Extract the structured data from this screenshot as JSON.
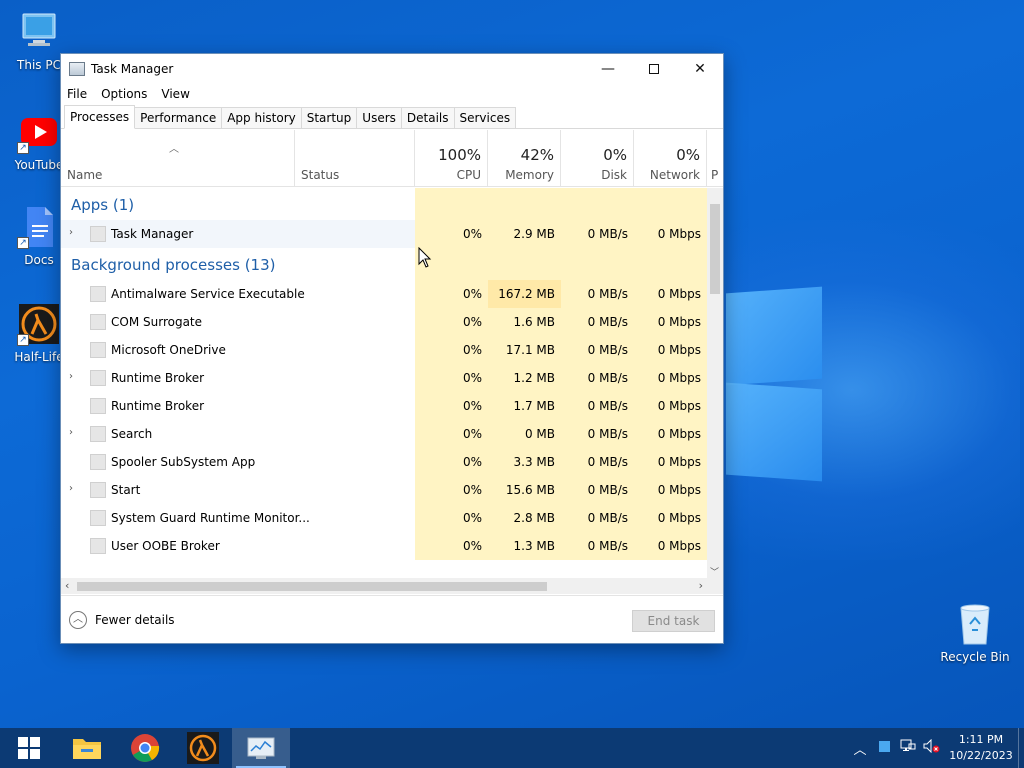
{
  "desktop": {
    "icons": [
      {
        "label": "This PC"
      },
      {
        "label": "YouTube"
      },
      {
        "label": "Docs"
      },
      {
        "label": "Half-Life"
      }
    ],
    "recycle_bin": "Recycle Bin"
  },
  "window": {
    "title": "Task Manager",
    "menu": [
      "File",
      "Options",
      "View"
    ],
    "tabs": [
      "Processes",
      "Performance",
      "App history",
      "Startup",
      "Users",
      "Details",
      "Services"
    ],
    "active_tab": "Processes",
    "columns": {
      "name": "Name",
      "status": "Status",
      "cpu": {
        "pct": "100%",
        "label": "CPU"
      },
      "memory": {
        "pct": "42%",
        "label": "Memory"
      },
      "disk": {
        "pct": "0%",
        "label": "Disk"
      },
      "network": {
        "pct": "0%",
        "label": "Network"
      },
      "power_partial": "P"
    },
    "groups": {
      "apps": "Apps (1)",
      "background": "Background processes (13)"
    },
    "apps": [
      {
        "name": "Task Manager",
        "cpu": "0%",
        "mem": "2.9 MB",
        "disk": "0 MB/s",
        "net": "0 Mbps",
        "expandable": true
      }
    ],
    "background": [
      {
        "name": "Antimalware Service Executable",
        "cpu": "0%",
        "mem": "167.2 MB",
        "disk": "0 MB/s",
        "net": "0 Mbps",
        "expandable": false
      },
      {
        "name": "COM Surrogate",
        "cpu": "0%",
        "mem": "1.6 MB",
        "disk": "0 MB/s",
        "net": "0 Mbps",
        "expandable": false
      },
      {
        "name": "Microsoft OneDrive",
        "cpu": "0%",
        "mem": "17.1 MB",
        "disk": "0 MB/s",
        "net": "0 Mbps",
        "expandable": false
      },
      {
        "name": "Runtime Broker",
        "cpu": "0%",
        "mem": "1.2 MB",
        "disk": "0 MB/s",
        "net": "0 Mbps",
        "expandable": true
      },
      {
        "name": "Runtime Broker",
        "cpu": "0%",
        "mem": "1.7 MB",
        "disk": "0 MB/s",
        "net": "0 Mbps",
        "expandable": false
      },
      {
        "name": "Search",
        "cpu": "0%",
        "mem": "0 MB",
        "disk": "0 MB/s",
        "net": "0 Mbps",
        "expandable": true
      },
      {
        "name": "Spooler SubSystem App",
        "cpu": "0%",
        "mem": "3.3 MB",
        "disk": "0 MB/s",
        "net": "0 Mbps",
        "expandable": false
      },
      {
        "name": "Start",
        "cpu": "0%",
        "mem": "15.6 MB",
        "disk": "0 MB/s",
        "net": "0 Mbps",
        "expandable": true
      },
      {
        "name": "System Guard Runtime Monitor...",
        "cpu": "0%",
        "mem": "2.8 MB",
        "disk": "0 MB/s",
        "net": "0 Mbps",
        "expandable": false
      },
      {
        "name": "User OOBE Broker",
        "cpu": "0%",
        "mem": "1.3 MB",
        "disk": "0 MB/s",
        "net": "0 Mbps",
        "expandable": false
      }
    ],
    "footer": {
      "fewer_details": "Fewer details",
      "end_task": "End task"
    }
  },
  "taskbar": {
    "clock_time": "1:11 PM",
    "clock_date": "10/22/2023"
  },
  "colors": {
    "heat_light": "#fff4c4",
    "heat_medium": "#ffe9a8",
    "group_title": "#1f5fa8"
  }
}
